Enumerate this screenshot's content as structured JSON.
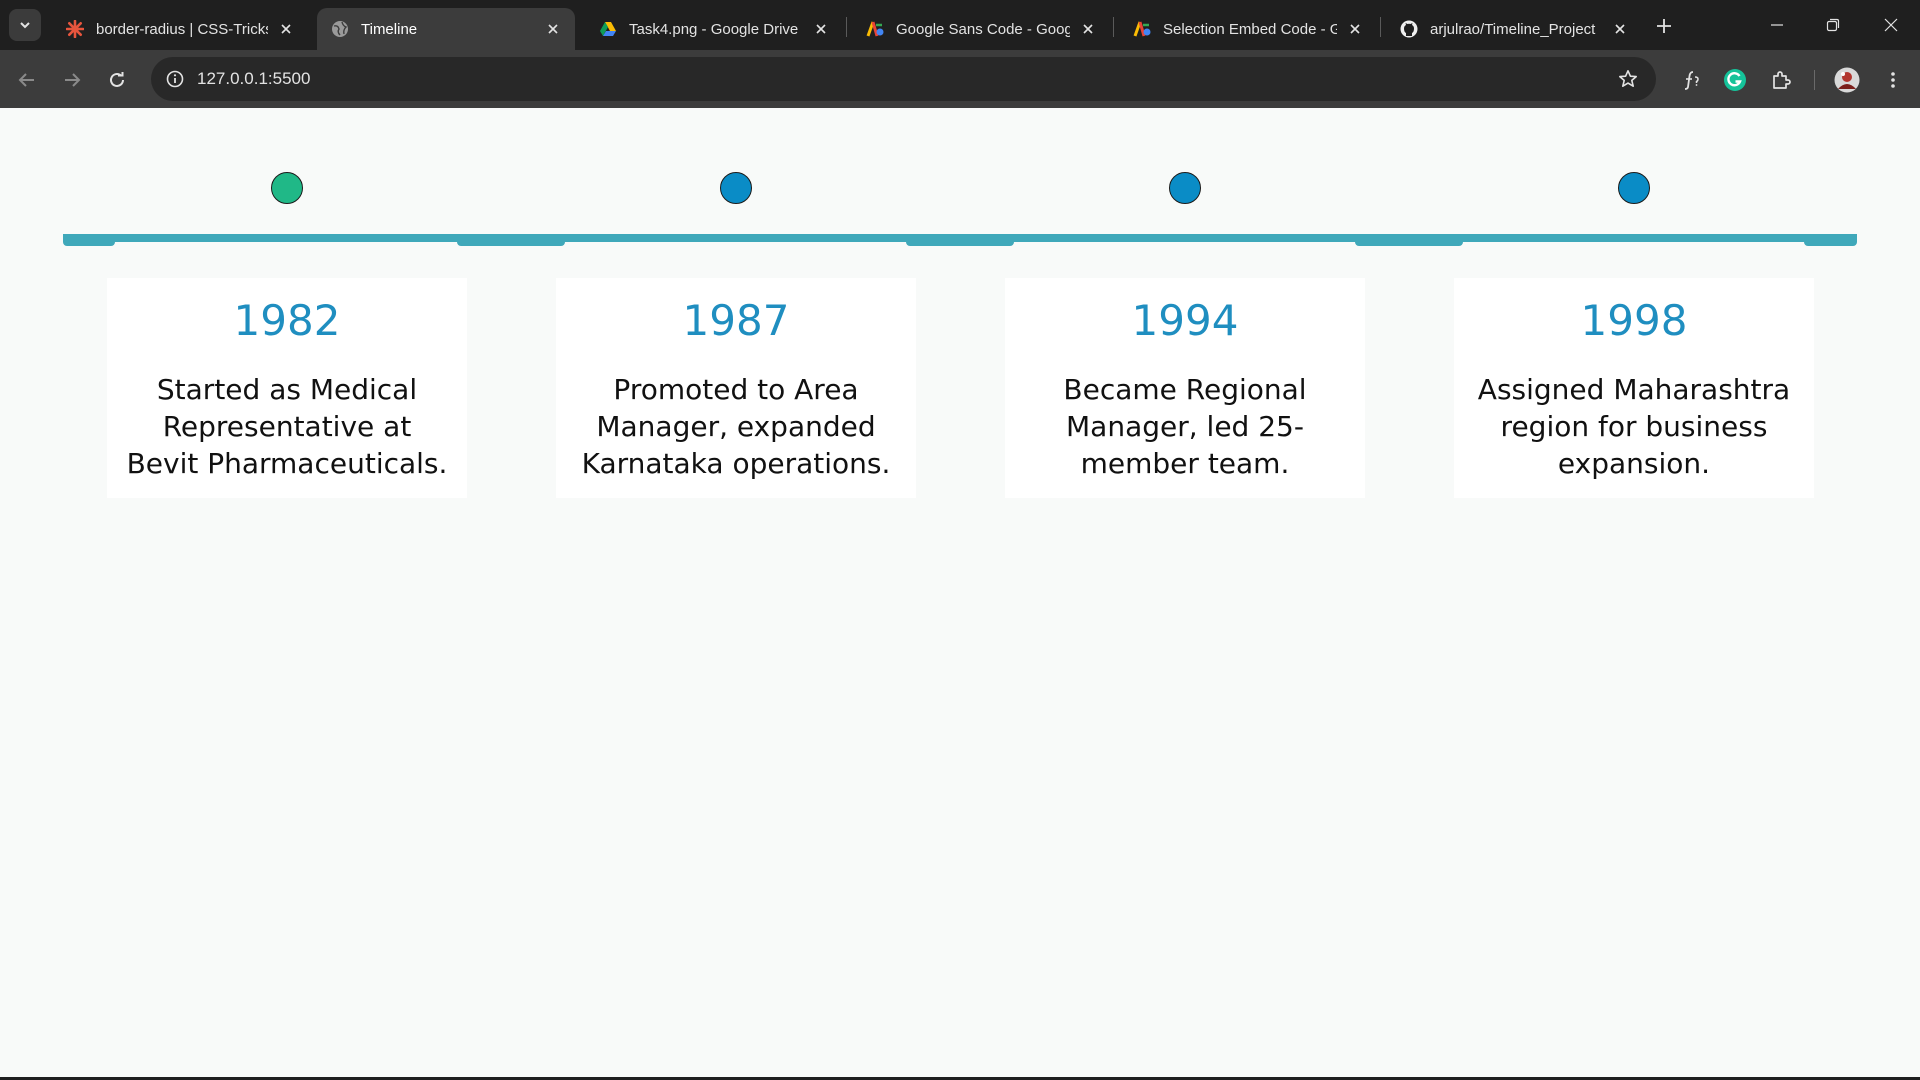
{
  "browser": {
    "tabs": [
      {
        "title": "border-radius | CSS-Tricks",
        "favicon": "css-tricks-icon"
      },
      {
        "title": "Timeline",
        "favicon": "globe-icon",
        "active": true
      },
      {
        "title": "Task4.png - Google Drive",
        "favicon": "google-drive-icon"
      },
      {
        "title": "Google Sans Code - Googl",
        "favicon": "google-fonts-icon"
      },
      {
        "title": "Selection Embed Code - Go",
        "favicon": "google-fonts-icon"
      },
      {
        "title": "arjulrao/Timeline_Project",
        "favicon": "github-icon"
      }
    ],
    "url": "127.0.0.1:5500"
  },
  "timeline": {
    "colors": {
      "line": "#3fa8ba",
      "first_dot": "#20b887",
      "dot": "#0a8cc6",
      "year": "#1f8ec0"
    },
    "events": [
      {
        "year": "1982",
        "text": "Started as Medical Representative at Bevit Pharmaceuticals."
      },
      {
        "year": "1987",
        "text": "Promoted to Area Manager, expanded Karnataka operations."
      },
      {
        "year": "1994",
        "text": "Became Regional Manager, led 25-member team."
      },
      {
        "year": "1998",
        "text": "Assigned Maharashtra region for business expansion."
      }
    ]
  }
}
